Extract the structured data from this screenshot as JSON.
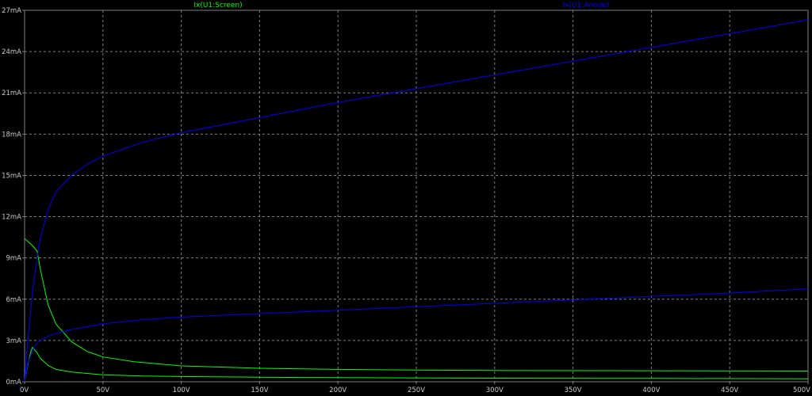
{
  "chart_data": {
    "type": "line",
    "title": "",
    "xlabel": "",
    "ylabel": "",
    "xlim": [
      0,
      500
    ],
    "ylim": [
      0,
      27
    ],
    "grid": true,
    "legend_placement": "top-center",
    "colors": {
      "background": "#000000",
      "grid": "#7f7f7f",
      "screen": "#00ff00",
      "anode": "#0000ff",
      "tick_text": "#c8c8c8"
    },
    "x_ticks": [
      {
        "value": 0,
        "label": "0V"
      },
      {
        "value": 50,
        "label": "50V"
      },
      {
        "value": 100,
        "label": "100V"
      },
      {
        "value": 150,
        "label": "150V"
      },
      {
        "value": 200,
        "label": "200V"
      },
      {
        "value": 250,
        "label": "250V"
      },
      {
        "value": 300,
        "label": "300V"
      },
      {
        "value": 350,
        "label": "350V"
      },
      {
        "value": 400,
        "label": "400V"
      },
      {
        "value": 450,
        "label": "450V"
      },
      {
        "value": 500,
        "label": "500V"
      }
    ],
    "y_ticks": [
      {
        "value": 0,
        "label": "0mA"
      },
      {
        "value": 3,
        "label": "3mA"
      },
      {
        "value": 6,
        "label": "6mA"
      },
      {
        "value": 9,
        "label": "9mA"
      },
      {
        "value": 12,
        "label": "12mA"
      },
      {
        "value": 15,
        "label": "15mA"
      },
      {
        "value": 18,
        "label": "18mA"
      },
      {
        "value": 21,
        "label": "21mA"
      },
      {
        "value": 24,
        "label": "24mA"
      },
      {
        "value": 27,
        "label": "27mA"
      }
    ],
    "legend": [
      {
        "label": "Ix(U1:Screen)",
        "color": "#00ff00"
      },
      {
        "label": "Ix(U1:Anode)",
        "color": "#0000ff"
      }
    ],
    "series": [
      {
        "group": "Ix(U1:Screen)",
        "color": "#00ff00",
        "x": [
          0,
          2,
          5,
          8,
          10,
          15,
          20,
          30,
          40,
          50,
          70,
          100,
          150,
          200,
          250,
          300,
          400,
          500
        ],
        "y": [
          10.4,
          10.2,
          9.9,
          9.5,
          8.2,
          5.6,
          4.2,
          2.9,
          2.2,
          1.8,
          1.45,
          1.15,
          0.98,
          0.9,
          0.85,
          0.82,
          0.8,
          0.78
        ]
      },
      {
        "group": "Ix(U1:Screen)",
        "color": "#00ff00",
        "x": [
          0,
          2,
          4,
          5,
          8,
          10,
          15,
          20,
          30,
          50,
          75,
          100,
          150,
          200,
          300,
          400,
          500
        ],
        "y": [
          0,
          1.2,
          2.2,
          2.5,
          2.1,
          1.7,
          1.2,
          0.9,
          0.7,
          0.5,
          0.42,
          0.38,
          0.33,
          0.3,
          0.26,
          0.24,
          0.22
        ]
      },
      {
        "group": "Ix(U1:Anode)",
        "color": "#0000ff",
        "x": [
          0,
          2,
          5,
          8,
          10,
          15,
          20,
          30,
          40,
          50,
          75,
          100,
          150,
          200,
          250,
          300,
          350,
          400,
          450,
          500
        ],
        "y": [
          0,
          3.0,
          6.5,
          9.0,
          10.4,
          12.5,
          13.8,
          15.0,
          15.8,
          16.4,
          17.4,
          18.1,
          19.2,
          20.3,
          21.3,
          22.3,
          23.3,
          24.3,
          25.3,
          26.3
        ]
      },
      {
        "group": "Ix(U1:Anode)",
        "color": "#0000ff",
        "x": [
          0,
          2,
          5,
          8,
          10,
          15,
          20,
          30,
          50,
          75,
          100,
          150,
          200,
          250,
          300,
          350,
          400,
          450,
          500
        ],
        "y": [
          0,
          1.3,
          2.3,
          2.8,
          3.0,
          3.3,
          3.5,
          3.8,
          4.2,
          4.5,
          4.7,
          4.95,
          5.2,
          5.45,
          5.7,
          5.95,
          6.2,
          6.45,
          6.75
        ]
      }
    ]
  }
}
